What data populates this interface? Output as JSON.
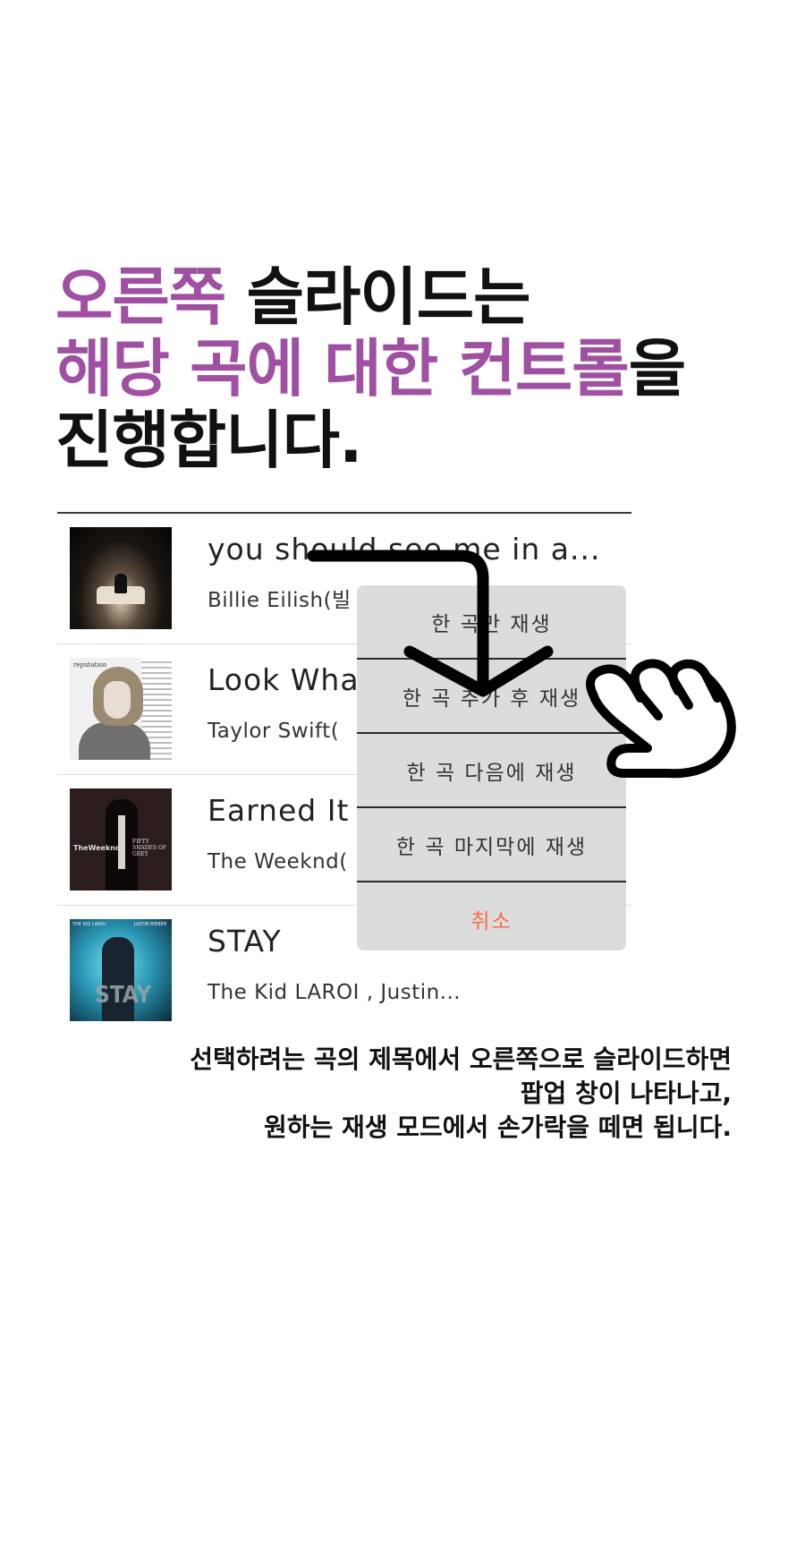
{
  "headline": {
    "line1_highlight": "오른쪽",
    "line1_rest": " 슬라이드는",
    "line2_highlight": "해당 곡에 대한 컨트롤",
    "line2_rest": "을",
    "line3": "진행합니다."
  },
  "songs": [
    {
      "title": "you should see me in a...",
      "artist": "Billie Eilish(빌"
    },
    {
      "title": "Look Wha",
      "artist": "Taylor Swift("
    },
    {
      "title": "Earned It",
      "artist": "The Weeknd("
    },
    {
      "title": "STAY",
      "artist": "The Kid LAROI , Justin..."
    }
  ],
  "album_art": {
    "taylor_swift_text": "reputation",
    "weeknd_text": "TheWeeknd",
    "weeknd_side_text": "FIFTY SHADES OF GREY",
    "stay_text": "STAY",
    "stay_top_left": "THE KID LAROI",
    "stay_top_right": "JUSTIN BIEBER"
  },
  "popup": {
    "items": [
      "한 곡만 재생",
      "한 곡 추가 후 재생",
      "한 곡 다음에 재생",
      "한 곡 마지막에 재생"
    ],
    "cancel": "취소"
  },
  "caption": {
    "line1": "선택하려는 곡의 제목에서 오른쪽으로 슬라이드하면",
    "line2": "팝업 창이 나타나고,",
    "line3": "원하는 재생 모드에서 손가락을 떼면 됩니다."
  },
  "colors": {
    "highlight": "#a050a2",
    "cancel": "#ff6a45",
    "popup_bg": "#dcdcdc"
  },
  "icons": [
    "down-arrow-icon",
    "pointing-hand-icon"
  ]
}
